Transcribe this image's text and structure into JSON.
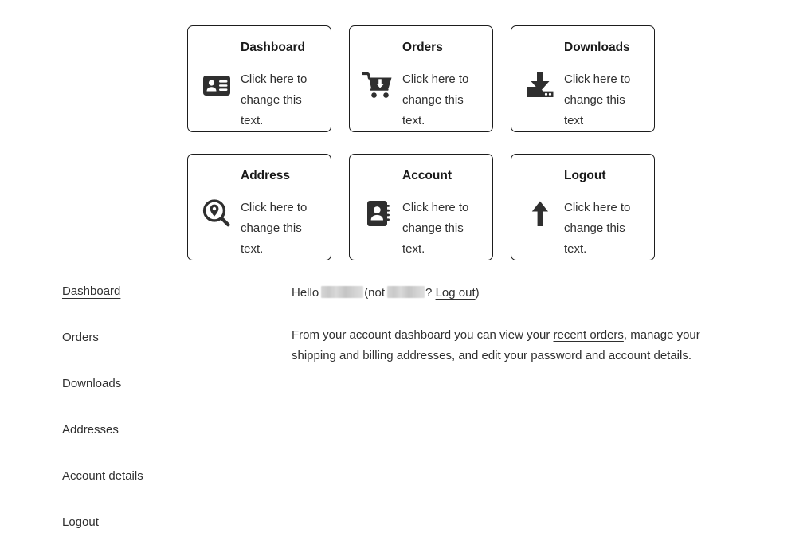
{
  "cards": [
    {
      "title": "Dashboard",
      "text": "Click here to change this text.",
      "icon": "id-card-icon",
      "width_class": "w-narrow"
    },
    {
      "title": "Orders",
      "text": "Click here to change this text.",
      "icon": "shopping-cart-download-icon",
      "width_class": "w-narrow"
    },
    {
      "title": "Downloads",
      "text": "Click here to change this text",
      "icon": "download-tray-icon",
      "width_class": "w-wider"
    },
    {
      "title": "Address",
      "text": "Click here to change this text.",
      "icon": "map-pin-search-icon",
      "width_class": "w-narrow"
    },
    {
      "title": "Account",
      "text": "Click here to change this text.",
      "icon": "address-book-icon",
      "width_class": "w-narrow"
    },
    {
      "title": "Logout",
      "text": "Click here to change this text.",
      "icon": "arrow-up-icon",
      "width_class": "w-wider"
    }
  ],
  "nav": {
    "items": [
      {
        "label": "Dashboard",
        "active": true
      },
      {
        "label": "Orders",
        "active": false
      },
      {
        "label": "Downloads",
        "active": false
      },
      {
        "label": "Addresses",
        "active": false
      },
      {
        "label": "Account details",
        "active": false
      },
      {
        "label": "Logout",
        "active": false
      }
    ]
  },
  "greeting": {
    "hello": "Hello",
    "not_open": "(not",
    "question": "?",
    "logout_link": "Log out",
    "close_paren": ")"
  },
  "intro": {
    "part_1": "From your account dashboard you can view your ",
    "link_orders": "recent orders",
    "part_2": ", manage your ",
    "link_addresses": "shipping and billing addresses",
    "part_3": ", and ",
    "link_account": "edit your password and account details",
    "part_4": "."
  },
  "colors": {
    "text": "#2f2f2f",
    "border": "#1d1d1d",
    "icon": "#2f2f2f",
    "background": "#ffffff",
    "redaction": "#d0d0d0"
  }
}
